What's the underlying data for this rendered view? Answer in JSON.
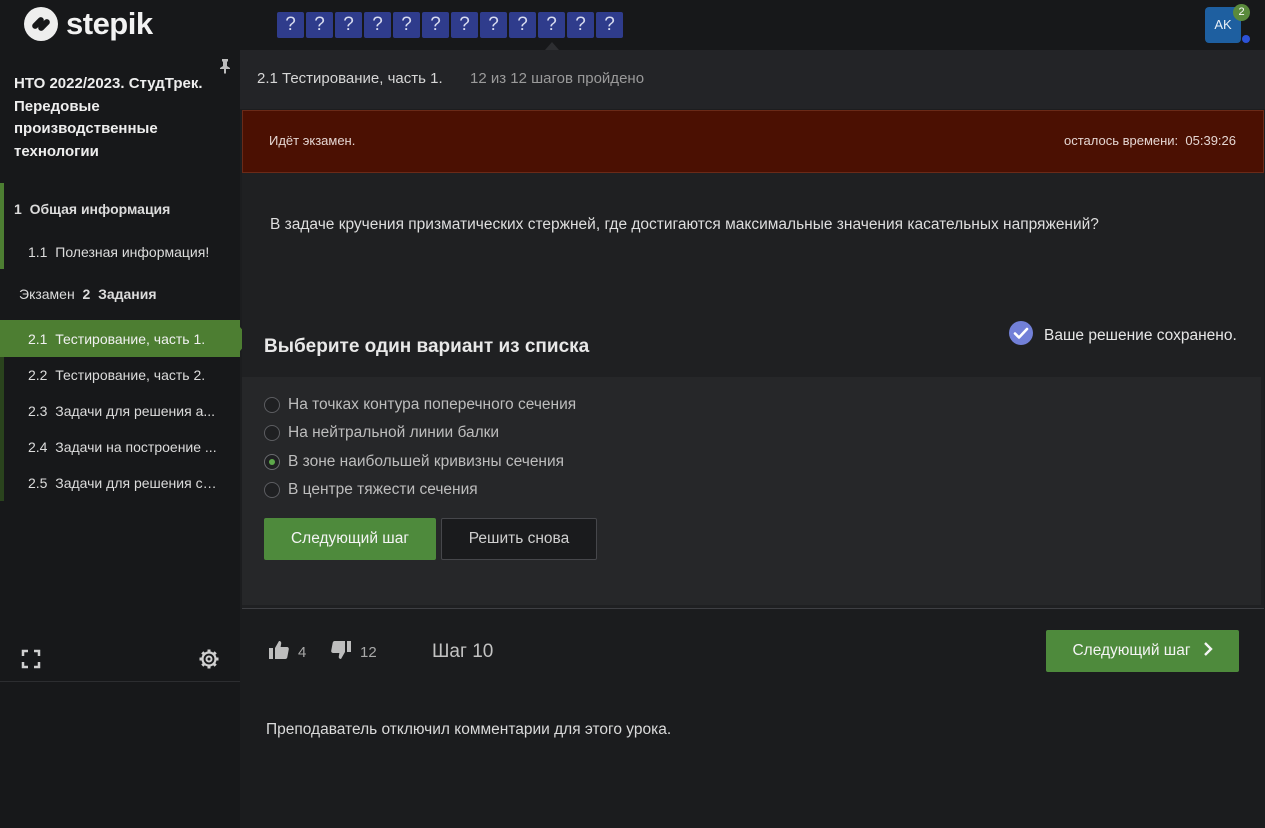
{
  "header": {
    "logo_text": "stepik",
    "steps": [
      "?",
      "?",
      "?",
      "?",
      "?",
      "?",
      "?",
      "?",
      "?",
      "?",
      "?",
      "?"
    ],
    "current_step_index": 9,
    "avatar_initials": "AK",
    "avatar_badge": "2"
  },
  "sidebar": {
    "course_title": "НТО 2022/2023. СтудТрек. Передовые производственные технологии",
    "items": [
      {
        "number": "1",
        "label": "Общая информация"
      },
      {
        "number": "1.1",
        "label": "Полезная информация!"
      },
      {
        "prefix": "Экзамен",
        "number": "2",
        "label": "Задания"
      },
      {
        "number": "2.1",
        "label": "Тестирование, часть 1."
      },
      {
        "number": "2.2",
        "label": "Тестирование, часть 2."
      },
      {
        "number": "2.3",
        "label": "Задачи для решения а..."
      },
      {
        "number": "2.4",
        "label": "Задачи на построение ..."
      },
      {
        "number": "2.5",
        "label": "Задачи для решения с ..."
      }
    ],
    "icons": {
      "pin": "pin-icon",
      "fullscreen": "fullscreen-icon",
      "settings": "gear-icon"
    }
  },
  "lesson": {
    "title": "2.1 Тестирование, часть 1.",
    "progress": "12 из 12 шагов пройдено"
  },
  "exam": {
    "status": "Идёт экзамен.",
    "time_left": "осталось времени:  05:39:26"
  },
  "question": {
    "text": "В задаче кручения призматических стержней, где достигаются максимальные значения касательных напряжений?",
    "choose_title": "Выберите один вариант из списка",
    "saved_text": "Ваше решение сохранено.",
    "options": [
      {
        "label": "На точках контура поперечного сечения",
        "checked": false
      },
      {
        "label": "На нейтральной линии балки",
        "checked": false
      },
      {
        "label": "В зоне наибольшей кривизны сечения",
        "checked": true
      },
      {
        "label": "В центре тяжести сечения",
        "checked": false
      }
    ],
    "next_button": "Следующий шаг",
    "retry_button": "Решить снова"
  },
  "footer": {
    "likes": "4",
    "dislikes": "12",
    "step_label": "Шаг 10",
    "next_button": "Следующий шаг",
    "comments_disabled": "Преподаватель отключил комментарии для этого урока."
  },
  "colors": {
    "accent_green": "#4e8a3c",
    "exam_banner": "#4b1002",
    "step_blue": "#2f3c8c"
  }
}
